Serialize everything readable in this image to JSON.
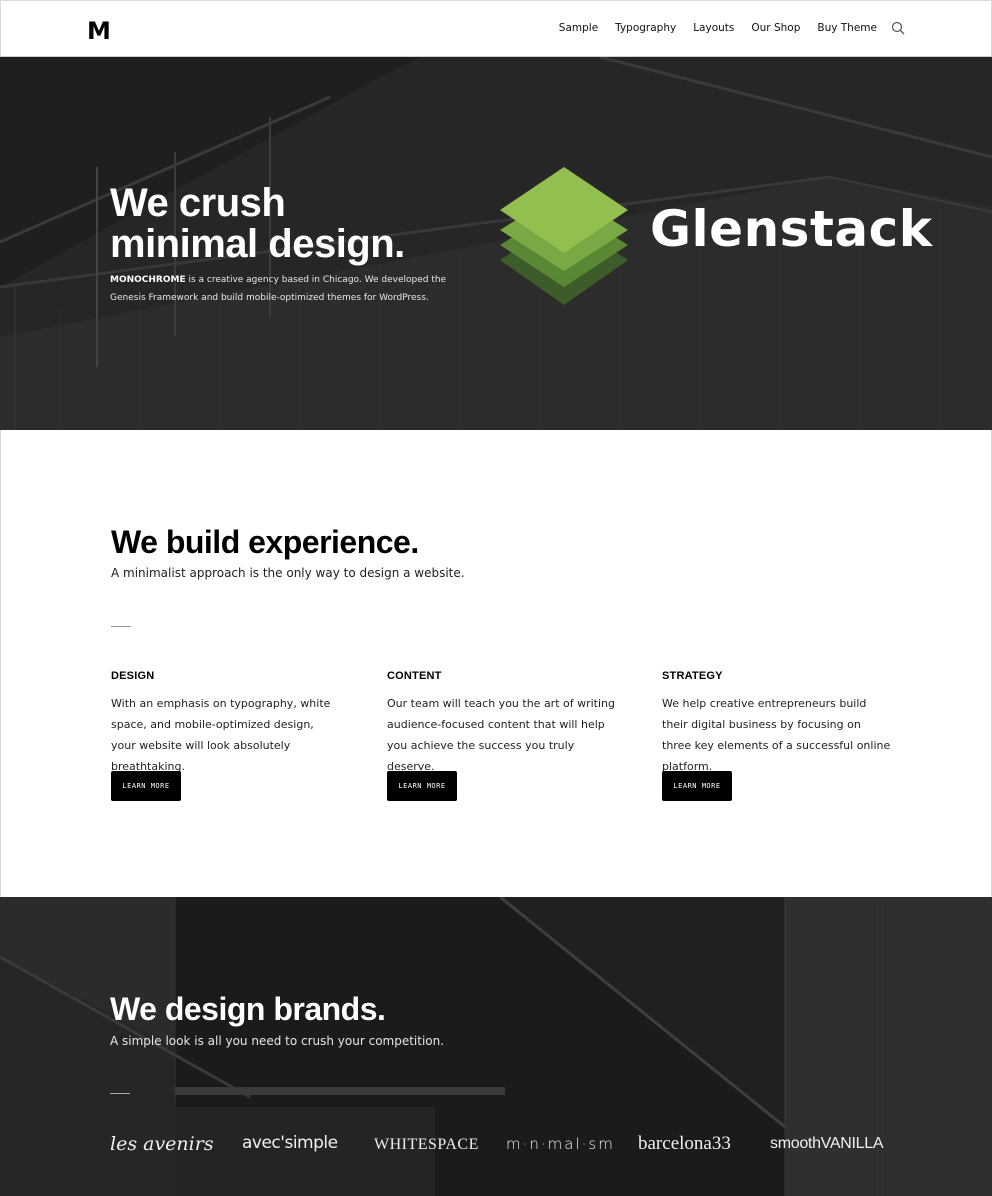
{
  "header": {
    "logo": "M",
    "nav": [
      "Sample",
      "Typography",
      "Layouts",
      "Our Shop",
      "Buy Theme"
    ],
    "search_icon": "search-icon"
  },
  "hero": {
    "title_line1": "We crush",
    "title_line2": "minimal design.",
    "desc_brand": "MONOCHROME",
    "desc_line1": " is a creative agency based in Chicago. We developed the",
    "desc_line2": "Genesis Framework and build mobile-optimized themes for WordPress.",
    "overlay_brand": "Glenstack",
    "overlay_colors": [
      "#8fbc4e",
      "#7aa844",
      "#5d8a35",
      "#3f5f2a"
    ]
  },
  "experience": {
    "title": "We build experience.",
    "subtitle": "A minimalist approach is the only way to design a website.",
    "columns": [
      {
        "heading": "DESIGN",
        "text": "With an emphasis on typography, white space, and mobile-optimized design, your website will look absolutely breathtaking.",
        "button": "LEARN MORE"
      },
      {
        "heading": "CONTENT",
        "text": "Our team will teach you the art of writing audience-focused content that will help you achieve the success you truly deserve.",
        "button": "LEARN MORE"
      },
      {
        "heading": "STRATEGY",
        "text": "We help creative entrepreneurs build their digital business by focusing on three key elements of a successful online platform.",
        "button": "LEARN MORE"
      }
    ]
  },
  "brands": {
    "title": "We design brands.",
    "subtitle": "A simple look is all you need to crush your competition.",
    "logos": [
      "les avenirs",
      "avec'simple",
      "WHITESPACE",
      "m·n·mal·sm",
      "barcelona33",
      "smoothVANILLA"
    ]
  }
}
